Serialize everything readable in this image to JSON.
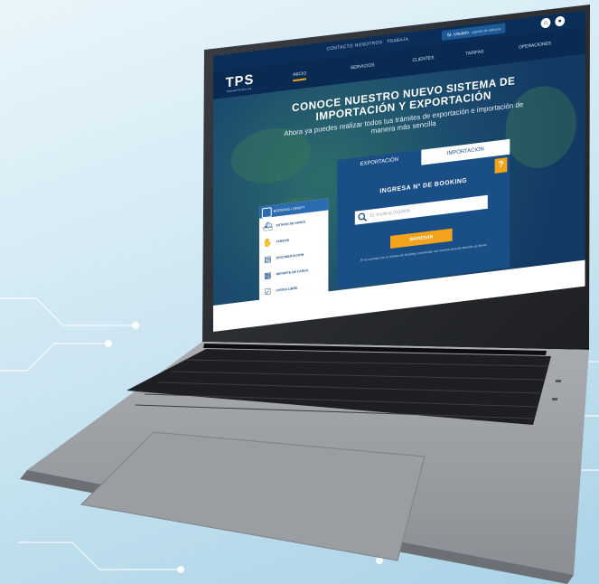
{
  "topbar": {
    "items": [
      "CONTACTO",
      "NOSOTROS",
      "TRABAJA"
    ],
    "user_label": "Sr. Usuario",
    "user_sub": "agente de aduana",
    "icons": [
      "home-icon",
      "user-icon"
    ]
  },
  "nav": {
    "logo": "TPS",
    "logo_sub": "Terminal Pacífico Sur",
    "items": [
      "INICIO",
      "SERVICIOS",
      "CLIENTES",
      "TARIFAS",
      "OPERACIONES"
    ]
  },
  "hero": {
    "title": "CONOCE NUESTRO NUEVO SISTEMA DE IMPORTACIÓN Y EXPORTACIÓN",
    "subtitle": "Ahora ya puedes realizar todos tus trámites de exportación e importación de manera más sencilla"
  },
  "tabs": {
    "export": "EXPORTACIÓN",
    "import": "IMPORTACIÓN",
    "help": "?"
  },
  "booking": {
    "title": "INGRESA Nº DE BOOKING",
    "placeholder": "Ej: booking 0123456",
    "submit": "INGRESAR",
    "note": "Si no cuentas con tu número de booking comunícate con nuestra área de atención al cliente"
  },
  "sidemenu": {
    "header": "BOOKING / DRAFT",
    "items": [
      {
        "label": "ESTADO DE NAVES",
        "icon": "ship-icon"
      },
      {
        "label": "TARIFAS",
        "icon": "hand-coin-icon"
      },
      {
        "label": "DOCUMENTACIÓN",
        "icon": "document-icon"
      },
      {
        "label": "REPORTE DE CARGA",
        "icon": "report-icon"
      },
      {
        "label": "CARGA LIBRE",
        "icon": "check-doc-icon"
      }
    ]
  },
  "colors": {
    "accent": "#f4a31c",
    "primary": "#1a4e86",
    "dark": "#0a2e57"
  }
}
